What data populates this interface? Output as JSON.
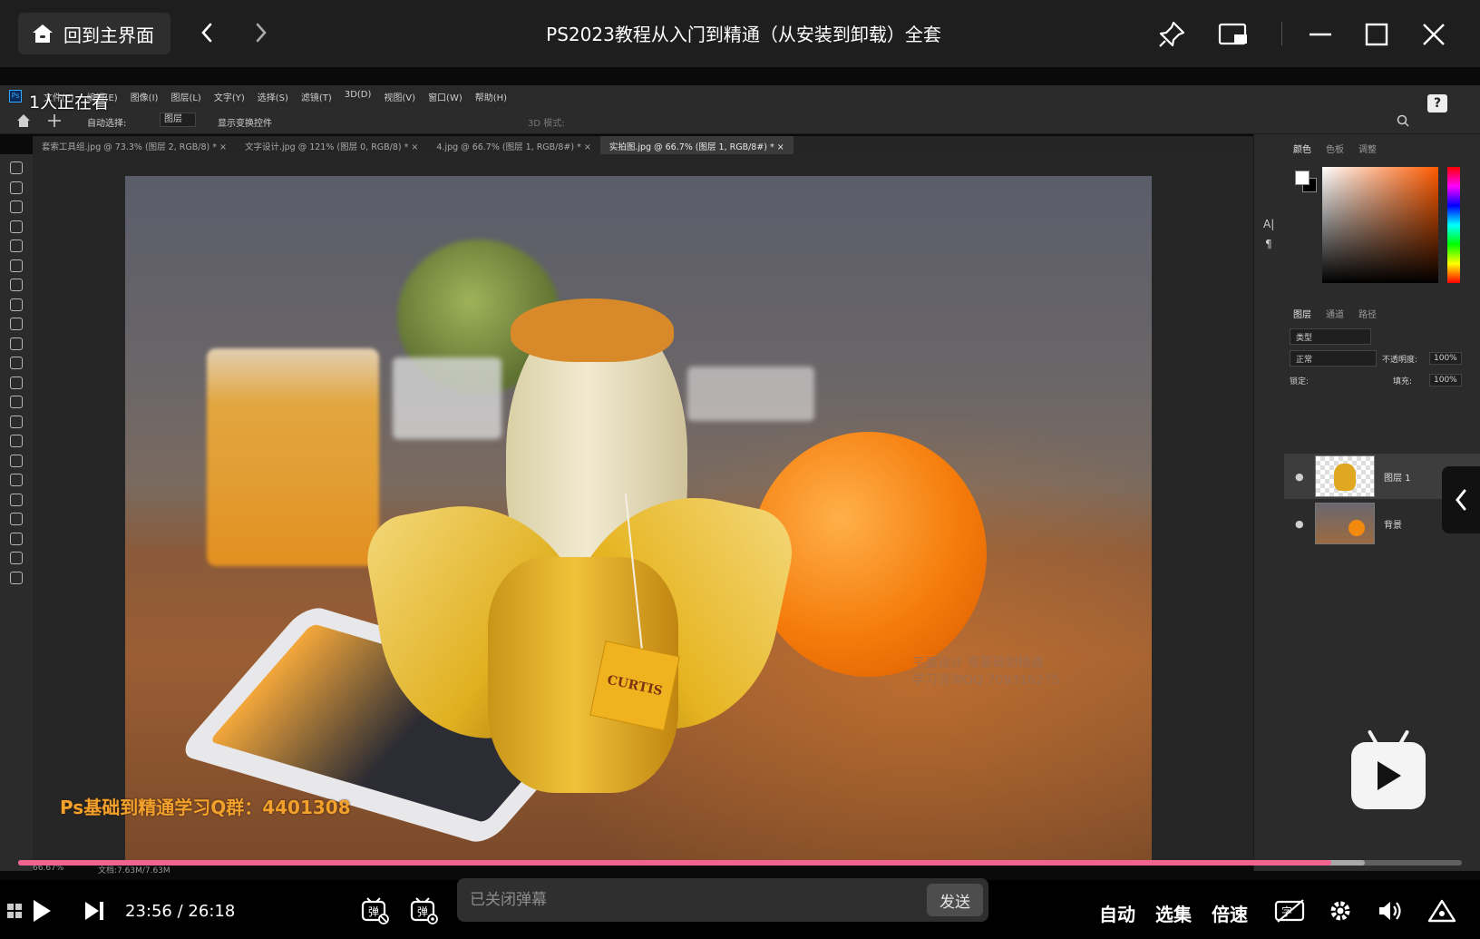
{
  "window": {
    "home_label": "回到主界面",
    "title": "PS2023教程从入门到精通（从安装到卸载）全套"
  },
  "overlay": {
    "viewers": "1人正在看",
    "qq_banner": "Ps基础到精通学习Q群：4401308"
  },
  "photoshop": {
    "menus": [
      "文件(F)",
      "编辑(E)",
      "图像(I)",
      "图层(L)",
      "文字(Y)",
      "选择(S)",
      "滤镜(T)",
      "3D(D)",
      "视图(V)",
      "窗口(W)",
      "帮助(H)"
    ],
    "options": {
      "auto_select": "自动选择:",
      "auto_select_value": "图层",
      "show_transform": "显示变换控件",
      "mode_3d": "3D 模式:"
    },
    "tabs": [
      {
        "label": "套索工具组.jpg @ 73.3% (图层 2, RGB/8) *  ×",
        "active": false
      },
      {
        "label": "文字设计.jpg @ 121% (图层 0, RGB/8) *  ×",
        "active": false
      },
      {
        "label": "4.jpg @ 66.7% (图层 1, RGB/8#) *  ×",
        "active": false
      },
      {
        "label": "实拍图.jpg @ 66.7% (图层 1, RGB/8#) *  ×",
        "active": true
      }
    ],
    "color_panel_tabs": [
      "颜色",
      "色板",
      "调整"
    ],
    "layer_panel_tabs": [
      "图层",
      "通道",
      "路径"
    ],
    "layer_filter": "类型",
    "blend_mode": "正常",
    "opacity_label": "不透明度:",
    "opacity_value": "100%",
    "lock_label": "锁定:",
    "fill_label": "填充:",
    "fill_value": "100%",
    "layers": [
      {
        "name": "图层 1",
        "selected": true
      },
      {
        "name": "背景",
        "selected": false
      }
    ],
    "status": {
      "zoom": "66.67%",
      "doc": "文档:7.63M/7.63M"
    },
    "canvas": {
      "tag_text": "CURTIS",
      "watermark_line1": "平面设计  零基础到精通",
      "watermark_line2": "学习咨询QQ 709316275"
    }
  },
  "player": {
    "current_time": "23:56",
    "separator": "/",
    "duration": "26:18",
    "progress": 0.9098,
    "buffered": 0.9328,
    "danmaku_placeholder": "已关闭弹幕",
    "send_label": "发送",
    "quality_label": "自动",
    "episodes_label": "选集",
    "speed_label": "倍速"
  },
  "colors": {
    "progress": "#f2648f",
    "banner": "#f1a12c",
    "titlebar": "#1e1e1e"
  }
}
